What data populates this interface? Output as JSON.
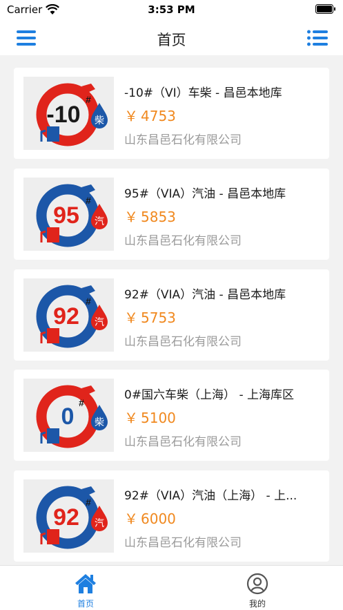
{
  "status_bar": {
    "carrier": "Carrier",
    "time": "3:53 PM"
  },
  "nav": {
    "title": "首页",
    "left_icon": "hamburger-menu-icon",
    "right_icon": "list-icon",
    "accent_color": "#1e7fe0"
  },
  "products": [
    {
      "name": "-10#（VI）车柴 - 昌邑本地库",
      "currency": "￥",
      "price": "4753",
      "company": "山东昌邑石化有限公司",
      "logo_grade": "-10",
      "logo_fuel": "柴",
      "logo_ring_color": "#e0241b"
    },
    {
      "name": "95#（VIA）汽油 - 昌邑本地库",
      "currency": "￥",
      "price": "5853",
      "company": "山东昌邑石化有限公司",
      "logo_grade": "95",
      "logo_fuel": "汽",
      "logo_ring_color": "#1c57a8"
    },
    {
      "name": "92#（VIA）汽油 - 昌邑本地库",
      "currency": "￥",
      "price": "5753",
      "company": "山东昌邑石化有限公司",
      "logo_grade": "92",
      "logo_fuel": "汽",
      "logo_ring_color": "#1c57a8"
    },
    {
      "name": "0#国六车柴（上海） - 上海库区",
      "currency": "￥",
      "price": "5100",
      "company": "山东昌邑石化有限公司",
      "logo_grade": "0",
      "logo_fuel": "柴",
      "logo_ring_color": "#e0241b"
    },
    {
      "name": "92#（VIA）汽油（上海） - 上...",
      "currency": "￥",
      "price": "6000",
      "company": "山东昌邑石化有限公司",
      "logo_grade": "92",
      "logo_fuel": "汽",
      "logo_ring_color": "#1c57a8"
    }
  ],
  "tab_bar": {
    "home_label": "首页",
    "home_icon": "home-icon",
    "mine_label": "我的",
    "mine_icon": "user-profile-icon",
    "active_color": "#1e7fe0"
  },
  "colors": {
    "price": "#f0881e",
    "company": "#9a9a9a"
  }
}
